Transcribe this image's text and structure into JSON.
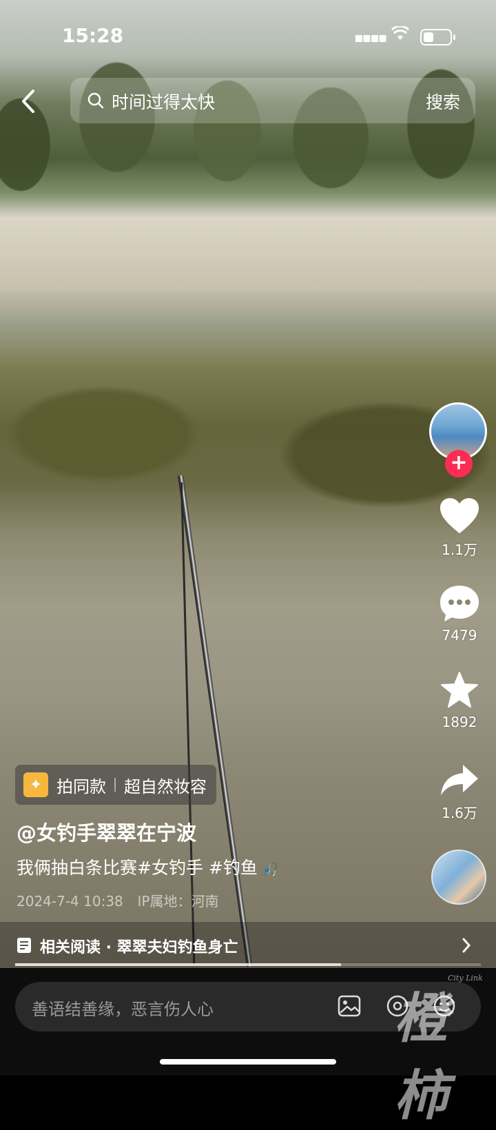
{
  "status_bar": {
    "time": "15:28"
  },
  "search": {
    "query": "时间过得太快",
    "button": "搜索"
  },
  "actions": {
    "likes": "1.1万",
    "comments": "7479",
    "favorites": "1892",
    "shares": "1.6万"
  },
  "tag": {
    "label": "拍同款",
    "effect": "超自然妆容"
  },
  "post": {
    "author": "@女钓手翠翠在宁波",
    "caption": "我俩抽白条比赛#女钓手 #钓鱼",
    "date": "2024-7-4 10:38",
    "ip": "IP属地：河南"
  },
  "related": {
    "text": "相关阅读 · 翠翠夫妇钓鱼身亡"
  },
  "progress": {
    "fraction": 0.7
  },
  "comment_bar": {
    "placeholder": "善语结善缘，恶言伤人心"
  },
  "watermark": {
    "brand": "橙柿",
    "sub": "City Link"
  }
}
